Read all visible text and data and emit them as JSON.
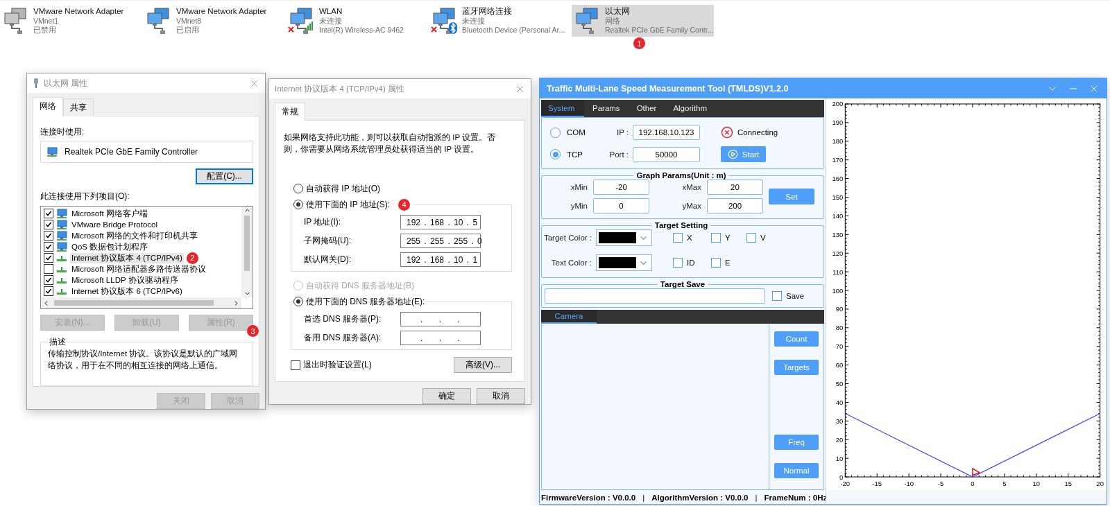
{
  "adapters": [
    {
      "kind": "vmware",
      "disabled": true,
      "disconnected": false,
      "selected": false,
      "lines": [
        "VMware Network Adapter",
        "VMnet1",
        "已禁用"
      ]
    },
    {
      "kind": "vmware",
      "disabled": false,
      "disconnected": false,
      "selected": false,
      "lines": [
        "VMware Network Adapter",
        "VMnet8",
        "已启用"
      ]
    },
    {
      "kind": "wifi",
      "disabled": false,
      "disconnected": true,
      "selected": false,
      "lines": [
        "WLAN",
        "未连接",
        "Intel(R) Wireless-AC 9462"
      ]
    },
    {
      "kind": "bluetooth",
      "disabled": false,
      "disconnected": true,
      "selected": false,
      "lines": [
        "蓝牙网络连接",
        "未连接",
        "Bluetooth Device (Personal Ar..."
      ]
    },
    {
      "kind": "ethernet",
      "disabled": false,
      "disconnected": false,
      "selected": true,
      "badge": "1",
      "lines": [
        "以太网",
        "网络",
        "Realtek PCIe GbE Family Contr..."
      ]
    }
  ],
  "properties_dialog": {
    "title": "以太网 属性",
    "tabs": [
      {
        "label": "网络",
        "selected": true
      },
      {
        "label": "共享",
        "selected": false
      }
    ],
    "connect_using_label": "连接时使用:",
    "adapter": "Realtek PCIe GbE Family Controller",
    "configure_button": {
      "label": "配置(C)...",
      "focused": true
    },
    "items_label": "此连接使用下列项目(O):",
    "items": [
      {
        "kind": "service",
        "label": "Microsoft 网络客户端",
        "checked": true,
        "selected": false
      },
      {
        "kind": "service",
        "label": "VMware Bridge Protocol",
        "checked": true,
        "selected": false
      },
      {
        "kind": "service",
        "label": "Microsoft 网络的文件和打印机共享",
        "checked": true,
        "selected": false
      },
      {
        "kind": "service",
        "label": "QoS 数据包计划程序",
        "checked": true,
        "selected": false
      },
      {
        "kind": "protocol",
        "label": "Internet 协议版本 4 (TCP/IPv4)",
        "checked": true,
        "selected": true,
        "badge": "2"
      },
      {
        "kind": "protocol",
        "label": "Microsoft 网络适配器多路传送器协议",
        "checked": false,
        "selected": false
      },
      {
        "kind": "protocol",
        "label": "Microsoft LLDP 协议驱动程序",
        "checked": true,
        "selected": false
      },
      {
        "kind": "protocol",
        "label": "Internet 协议版本 6 (TCP/IPv6)",
        "checked": true,
        "selected": false
      }
    ],
    "item_buttons": [
      {
        "label": "安装(N)...",
        "disabled": true
      },
      {
        "label": "卸载(U)",
        "disabled": true
      },
      {
        "label": "属性(R)",
        "disabled": true,
        "badge": "3"
      }
    ],
    "description": {
      "title": "描述",
      "text": "传输控制协议/Internet 协议。该协议是默认的广域网络协议，用于在不同的相互连接的网络上通信。"
    },
    "buttons": [
      {
        "label": "关闭",
        "disabled": true
      },
      {
        "label": "取消",
        "disabled": true
      }
    ]
  },
  "ipv4_dialog": {
    "title": "Internet 协议版本 4 (TCP/IPv4) 属性",
    "tabs": [
      {
        "label": "常规",
        "selected": true
      }
    ],
    "intro": "如果网络支持此功能，则可以获取自动指派的 IP 设置。否则，你需要从网络系统管理员处获得适当的 IP 设置。",
    "ip_options": [
      {
        "label": "自动获得 IP 地址(O)",
        "selected": false,
        "disabled": false
      },
      {
        "label": "使用下面的 IP 地址(S):",
        "selected": true,
        "disabled": false,
        "badge": "4"
      }
    ],
    "ip_fields": [
      {
        "label": "IP 地址(I):",
        "value": "192 . 168 . 10 . 5"
      },
      {
        "label": "子网掩码(U):",
        "value": "255 . 255 . 255 . 0"
      },
      {
        "label": "默认网关(D):",
        "value": "192 . 168 . 10 . 1"
      }
    ],
    "dns_options": [
      {
        "label": "自动获得 DNS 服务器地址(B)",
        "selected": false,
        "disabled": true
      },
      {
        "label": "使用下面的 DNS 服务器地址(E):",
        "selected": true,
        "disabled": false
      }
    ],
    "dns_fields": [
      {
        "label": "首选 DNS 服务器(P):",
        "value": ". . ."
      },
      {
        "label": "备用 DNS 服务器(A):",
        "value": ". . ."
      }
    ],
    "validate": {
      "label": "退出时验证设置(L)",
      "checked": false
    },
    "advanced_button": "高级(V)...",
    "buttons": [
      "确定",
      "取消"
    ]
  },
  "tmlds": {
    "title": "Traffic Multi-Lane Speed Measurement Tool (TMLDS)V1.2.0",
    "tabs": [
      {
        "label": "System",
        "selected": true
      },
      {
        "label": "Params",
        "selected": false
      },
      {
        "label": "Other",
        "selected": false
      },
      {
        "label": "Algorithm",
        "selected": false
      }
    ],
    "connection": {
      "modes": [
        {
          "label": "COM",
          "selected": false
        },
        {
          "label": "TCP",
          "selected": true
        }
      ],
      "ip_label": "IP :",
      "ip": "192.168.10.123",
      "port_label": "Port :",
      "port": "50000",
      "status": "Connecting",
      "connected": false,
      "start_button": "Start"
    },
    "graph_params": {
      "title": "Graph Params(Unit : m)",
      "fields": [
        {
          "label": "xMin",
          "value": "-20"
        },
        {
          "label": "xMax",
          "value": "20"
        },
        {
          "label": "yMin",
          "value": "0"
        },
        {
          "label": "yMax",
          "value": "200"
        }
      ],
      "set_button": "Set"
    },
    "target_setting": {
      "title": "Target Setting",
      "rows": [
        {
          "label": "Target Color :",
          "color": "#000000",
          "options": [
            {
              "label": "X",
              "checked": false
            },
            {
              "label": "Y",
              "checked": false
            },
            {
              "label": "V",
              "checked": false
            }
          ]
        },
        {
          "label": "Text Color :",
          "color": "#000000",
          "options": [
            {
              "label": "ID",
              "checked": false
            },
            {
              "label": "E",
              "checked": false
            }
          ]
        }
      ]
    },
    "target_save": {
      "title": "Target Save",
      "save": {
        "label": "Save",
        "checked": false
      }
    },
    "camera": {
      "tabs": [
        {
          "label": "Camera",
          "selected": true
        }
      ],
      "buttons": [
        "Count",
        "Targets",
        "Freq",
        "Normal"
      ]
    },
    "chart_data": {
      "type": "line",
      "x": [
        -20,
        0,
        20
      ],
      "series": [
        {
          "color": "#4040ff",
          "values": [
            34,
            0,
            34
          ]
        }
      ],
      "xlim": [
        -20,
        20
      ],
      "ylim": [
        0,
        200
      ],
      "xticks": [
        -20,
        -15,
        -10,
        -5,
        0,
        5,
        10,
        15,
        20
      ],
      "yticks": [
        0,
        10,
        20,
        30,
        40,
        50,
        60,
        70,
        80,
        90,
        100,
        110,
        120,
        130,
        140,
        150,
        160,
        170,
        180,
        190,
        200
      ]
    },
    "status_bar": [
      "FirmwareVersion : V0.0.0",
      "|",
      "AlgorithmVersion : V0.0.0",
      "|",
      "FrameNum : 0Hz"
    ]
  }
}
